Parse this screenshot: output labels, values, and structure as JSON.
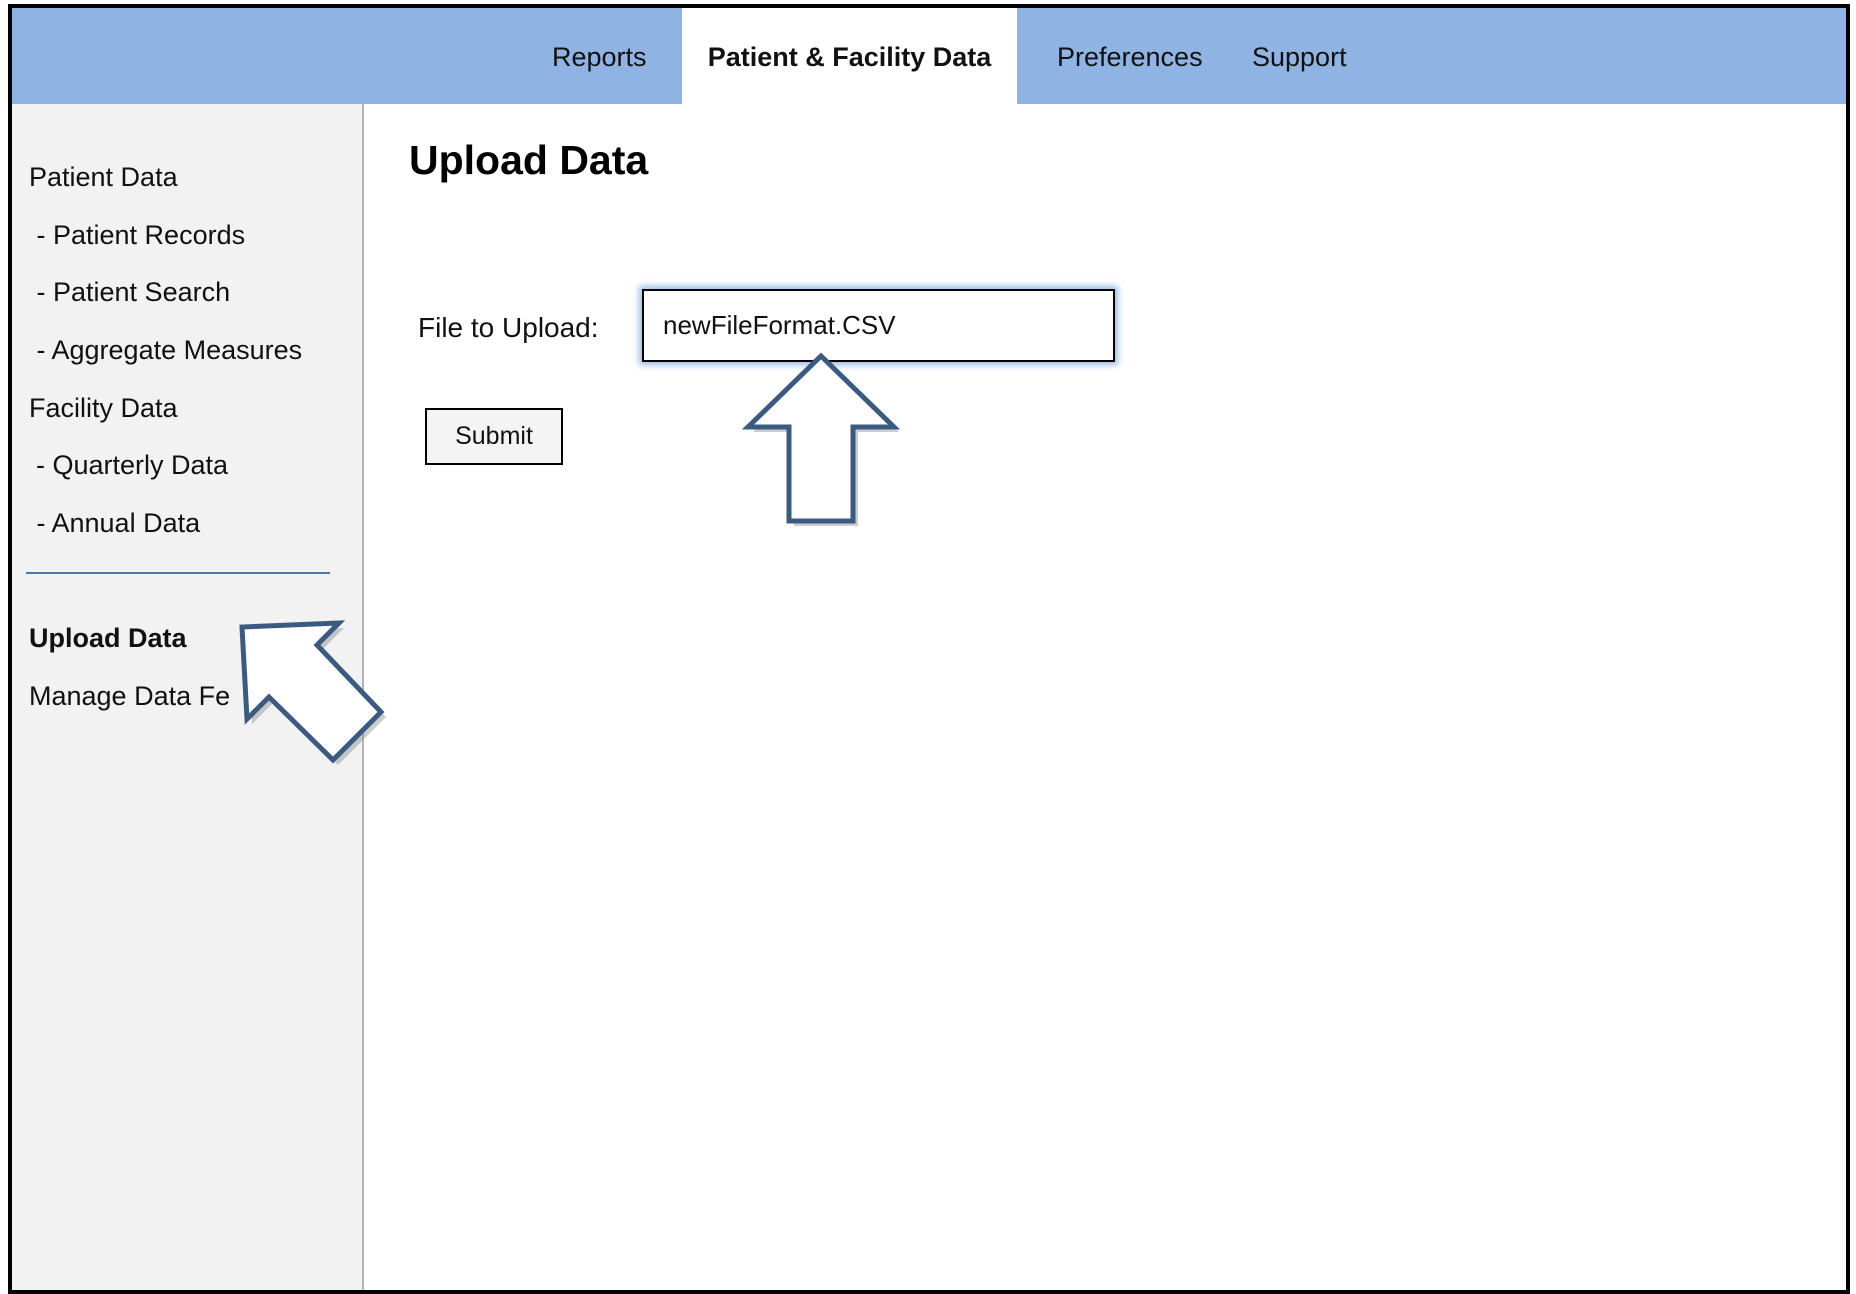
{
  "topnav": {
    "tabs": [
      {
        "label": "Reports",
        "active": false
      },
      {
        "label": "Patient & Facility Data",
        "active": true
      },
      {
        "label": "Preferences",
        "active": false
      },
      {
        "label": "Support",
        "active": false
      }
    ],
    "bar_color": "#8fb3e3"
  },
  "sidebar": {
    "items": [
      {
        "label": "Patient Data",
        "selected": false
      },
      {
        "label": " - Patient Records",
        "selected": false
      },
      {
        "label": " - Patient Search",
        "selected": false
      },
      {
        "label": " - Aggregate Measures",
        "selected": false
      },
      {
        "label": "Facility Data",
        "selected": false
      },
      {
        "label": "- Quarterly Data",
        "selected": false
      },
      {
        "label": " - Annual Data",
        "selected": false
      },
      {
        "label": "Upload Data",
        "selected": true
      },
      {
        "label": "Manage Data Fe",
        "selected": false
      }
    ],
    "background": "#f2f2f2"
  },
  "main": {
    "title": "Upload Data",
    "file_label": "File to Upload:",
    "file_value": "newFileFormat.CSV",
    "submit_label": "Submit"
  },
  "annotations": {
    "arrow_color": "#3b5a82",
    "arrows": [
      {
        "icon": "up-arrow-icon",
        "points_to": "file-input"
      },
      {
        "icon": "diagonal-arrow-icon",
        "points_to": "sidebar-item-upload-data"
      }
    ]
  }
}
